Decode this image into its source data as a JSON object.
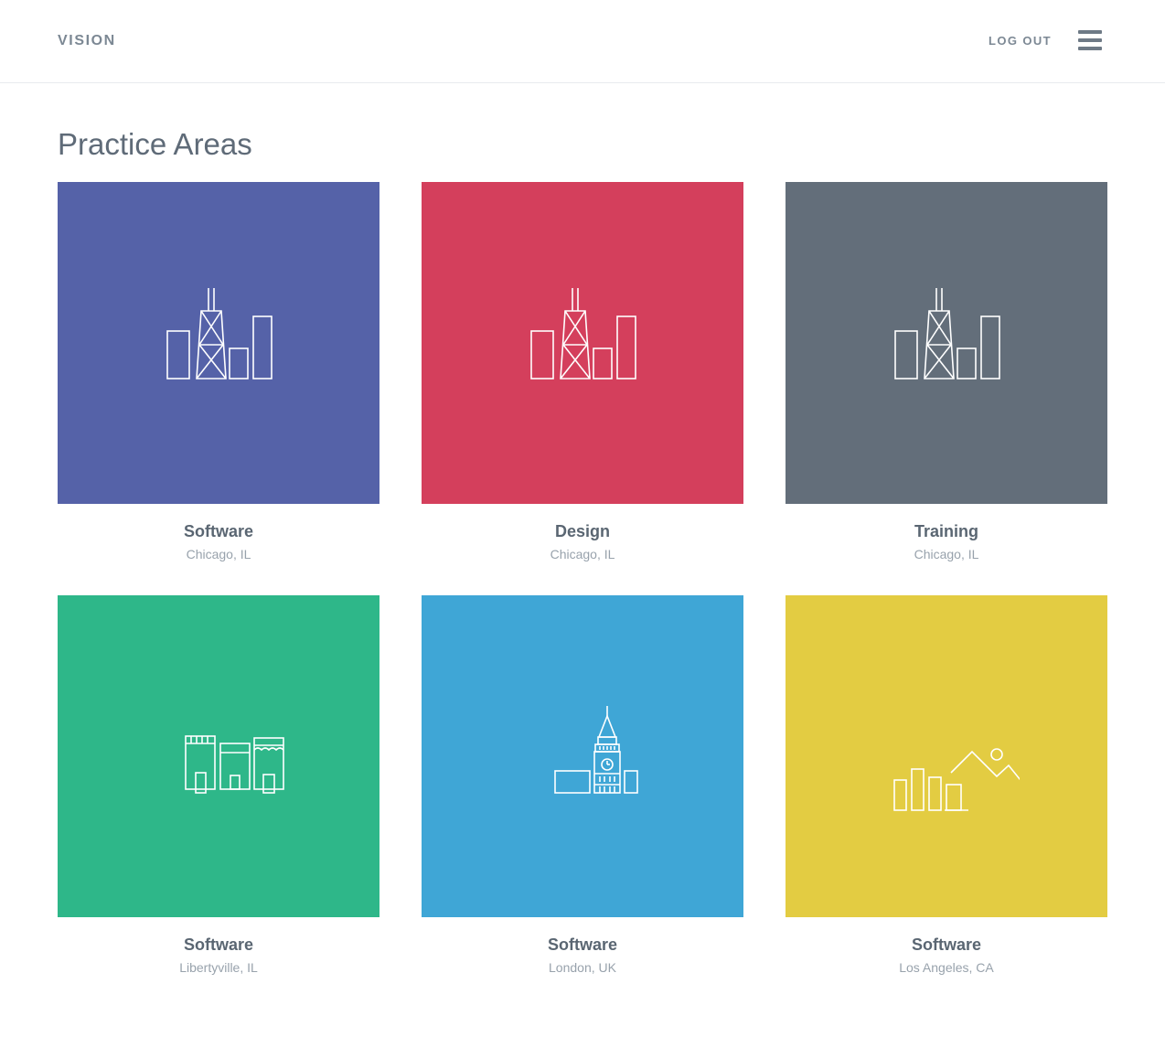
{
  "header": {
    "brand": "VISION",
    "logout_label": "LOG OUT",
    "menu_icon": "hamburger-menu-icon"
  },
  "main": {
    "title": "Practice Areas",
    "tiles": [
      {
        "name": "Software",
        "location": "Chicago, IL",
        "color": "#5562a8",
        "icon": "chicago-skyline-icon"
      },
      {
        "name": "Design",
        "location": "Chicago, IL",
        "color": "#d43f5c",
        "icon": "chicago-skyline-icon"
      },
      {
        "name": "Training",
        "location": "Chicago, IL",
        "color": "#636e7a",
        "icon": "chicago-skyline-icon"
      },
      {
        "name": "Software",
        "location": "Libertyville, IL",
        "color": "#2eb789",
        "icon": "storefronts-icon"
      },
      {
        "name": "Software",
        "location": "London, UK",
        "color": "#3fa6d6",
        "icon": "big-ben-icon"
      },
      {
        "name": "Software",
        "location": "Los Angeles, CA",
        "color": "#e3cc42",
        "icon": "la-hills-icon"
      }
    ]
  }
}
